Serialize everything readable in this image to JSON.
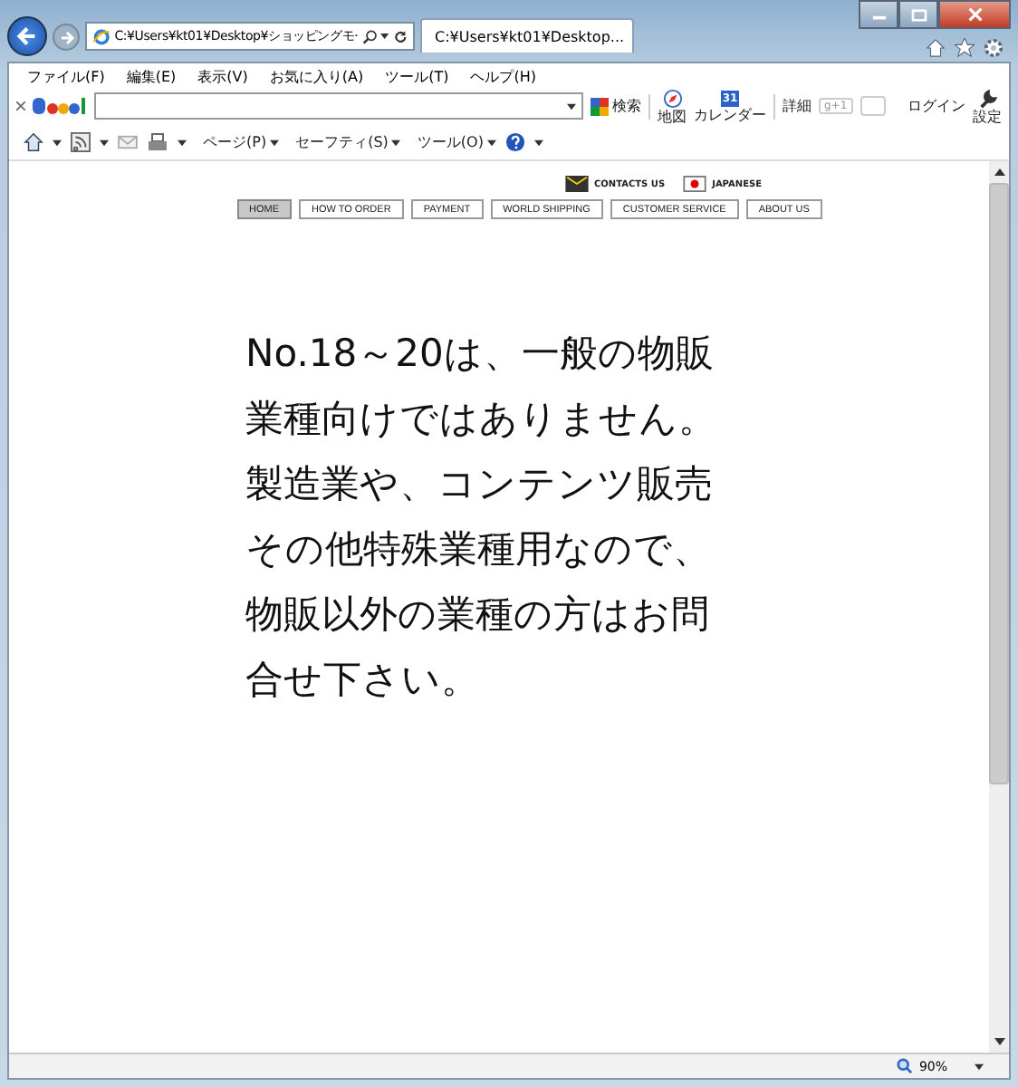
{
  "browser": {
    "address": "C:¥Users¥kt01¥Desktop¥ショッピングモ·",
    "tabs": [
      {
        "title": "C:¥Users¥kt01¥Desktop...",
        "selected": true
      }
    ],
    "menu": [
      "ファイル(F)",
      "編集(E)",
      "表示(V)",
      "お気に入り(A)",
      "ツール(T)",
      "ヘルプ(H)"
    ],
    "google_toolbar": {
      "search_label": "検索",
      "map_label": "地図",
      "calendar_label": "カレンダー",
      "calendar_day": "31",
      "details_label": "詳細",
      "plus_label": "g+1",
      "login_label": "ログイン",
      "settings_label": "設定"
    },
    "command_bar": [
      "ページ(P)",
      "セーフティ(S)",
      "ツール(O)"
    ],
    "zoom": "90%"
  },
  "page": {
    "top_links": [
      {
        "label": "CONTACTS US",
        "kind": "contact"
      },
      {
        "label": "JAPANESE",
        "kind": "flag"
      }
    ],
    "nav": [
      {
        "label": "HOME",
        "selected": true
      },
      {
        "label": "HOW TO ORDER",
        "selected": false
      },
      {
        "label": "PAYMENT",
        "selected": false
      },
      {
        "label": "WORLD SHIPPING",
        "selected": false
      },
      {
        "label": "CUSTOMER SERVICE",
        "selected": false
      },
      {
        "label": "ABOUT US",
        "selected": false
      }
    ],
    "message_lines": [
      "No.18～20は、一般の物販",
      "業種向けではありません。",
      "製造業や、コンテンツ販売",
      "その他特殊業種用なので、",
      "物販以外の業種の方はお問",
      "合せ下さい。"
    ]
  }
}
